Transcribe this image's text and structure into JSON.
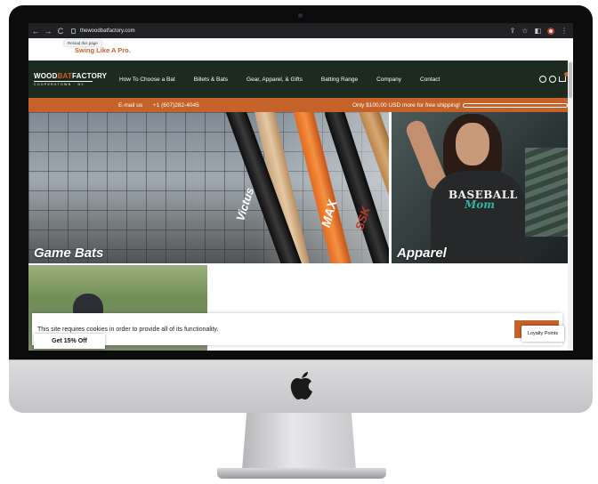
{
  "browser": {
    "url": "thewoodbatfactory.com",
    "tooltip": "Reload this page",
    "back_glyph": "←",
    "forward_glyph": "→",
    "reload_glyph": "C",
    "share_glyph": "⇪",
    "star_glyph": "☆",
    "sidebar_glyph": "◧",
    "menu_glyph": "⋮"
  },
  "site": {
    "tagline": "Swing Like A Pro.",
    "logo": {
      "part1": "WOOD",
      "part2": "BAT",
      "part3": "FACTORY",
      "sub": "COOPERSTOWN · NY"
    },
    "nav": [
      "How To Choose a Bat",
      "Billets & Bats",
      "Gear, Apparel, & Gifts",
      "Batting Range",
      "Company",
      "Contact"
    ],
    "header_icons": [
      "account-icon",
      "search-icon",
      "cart-icon"
    ]
  },
  "announcement": {
    "email": "E-mail us",
    "phone": "+1 (607)282-4045",
    "shipping_text": "Only $100.00 USD more for free shipping!",
    "shipping_progress": 0.0
  },
  "tiles": {
    "bats": {
      "caption": "Game Bats",
      "bat_labels": [
        "Victus",
        "MAX",
        "SSK"
      ]
    },
    "apparel": {
      "caption": "Apparel",
      "shirt_line1": "BASEBALL",
      "shirt_line2": "Mom"
    }
  },
  "cookie": {
    "message": "This site requires cookies in order to provide all of its functionality."
  },
  "widgets": {
    "discount_tab": "Get 15% Off",
    "loyalty": "Loyalty Points"
  },
  "colors": {
    "brand_orange": "#c4622a",
    "header_green": "#1d2a1f",
    "shirt_teal": "#35b3a8"
  }
}
